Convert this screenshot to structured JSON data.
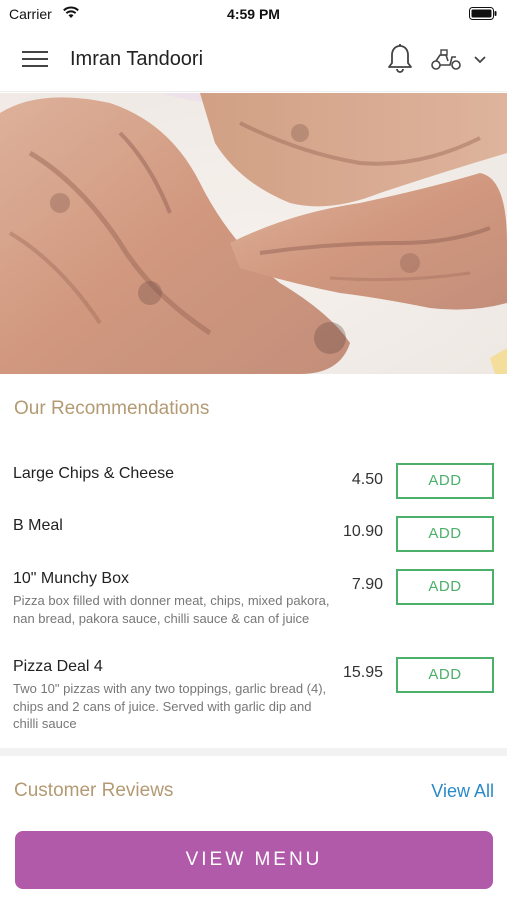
{
  "status_bar": {
    "carrier": "Carrier",
    "time": "4:59 PM"
  },
  "app_bar": {
    "title": "Imran Tandoori",
    "icons": [
      "menu-icon",
      "bell-icon",
      "scooter-icon",
      "chevron-down-icon"
    ]
  },
  "hero": {
    "description": "food photo"
  },
  "recommendations": {
    "title": "Our Recommendations",
    "add_label": "ADD",
    "items": [
      {
        "name": "Large Chips & Cheese",
        "description": "",
        "price": "4.50"
      },
      {
        "name": "B Meal",
        "description": "",
        "price": "10.90"
      },
      {
        "name": "10\" Munchy Box",
        "description": "Pizza box filled with donner meat, chips, mixed pakora, nan bread, pakora sauce, chilli sauce & can of juice",
        "price": "7.90"
      },
      {
        "name": "Pizza Deal 4",
        "description": "Two 10\" pizzas with any two toppings, garlic bread (4), chips and 2 cans of juice. Served with garlic dip and chilli sauce",
        "price": "15.95"
      }
    ]
  },
  "reviews": {
    "title": "Customer Reviews",
    "view_all": "View All"
  },
  "cta": {
    "label": "VIEW MENU"
  },
  "colors": {
    "accent_green": "#4caf6a",
    "brand_purple": "#b05aa9",
    "section_title": "#b49a73",
    "link_blue": "#2b8ac6"
  }
}
